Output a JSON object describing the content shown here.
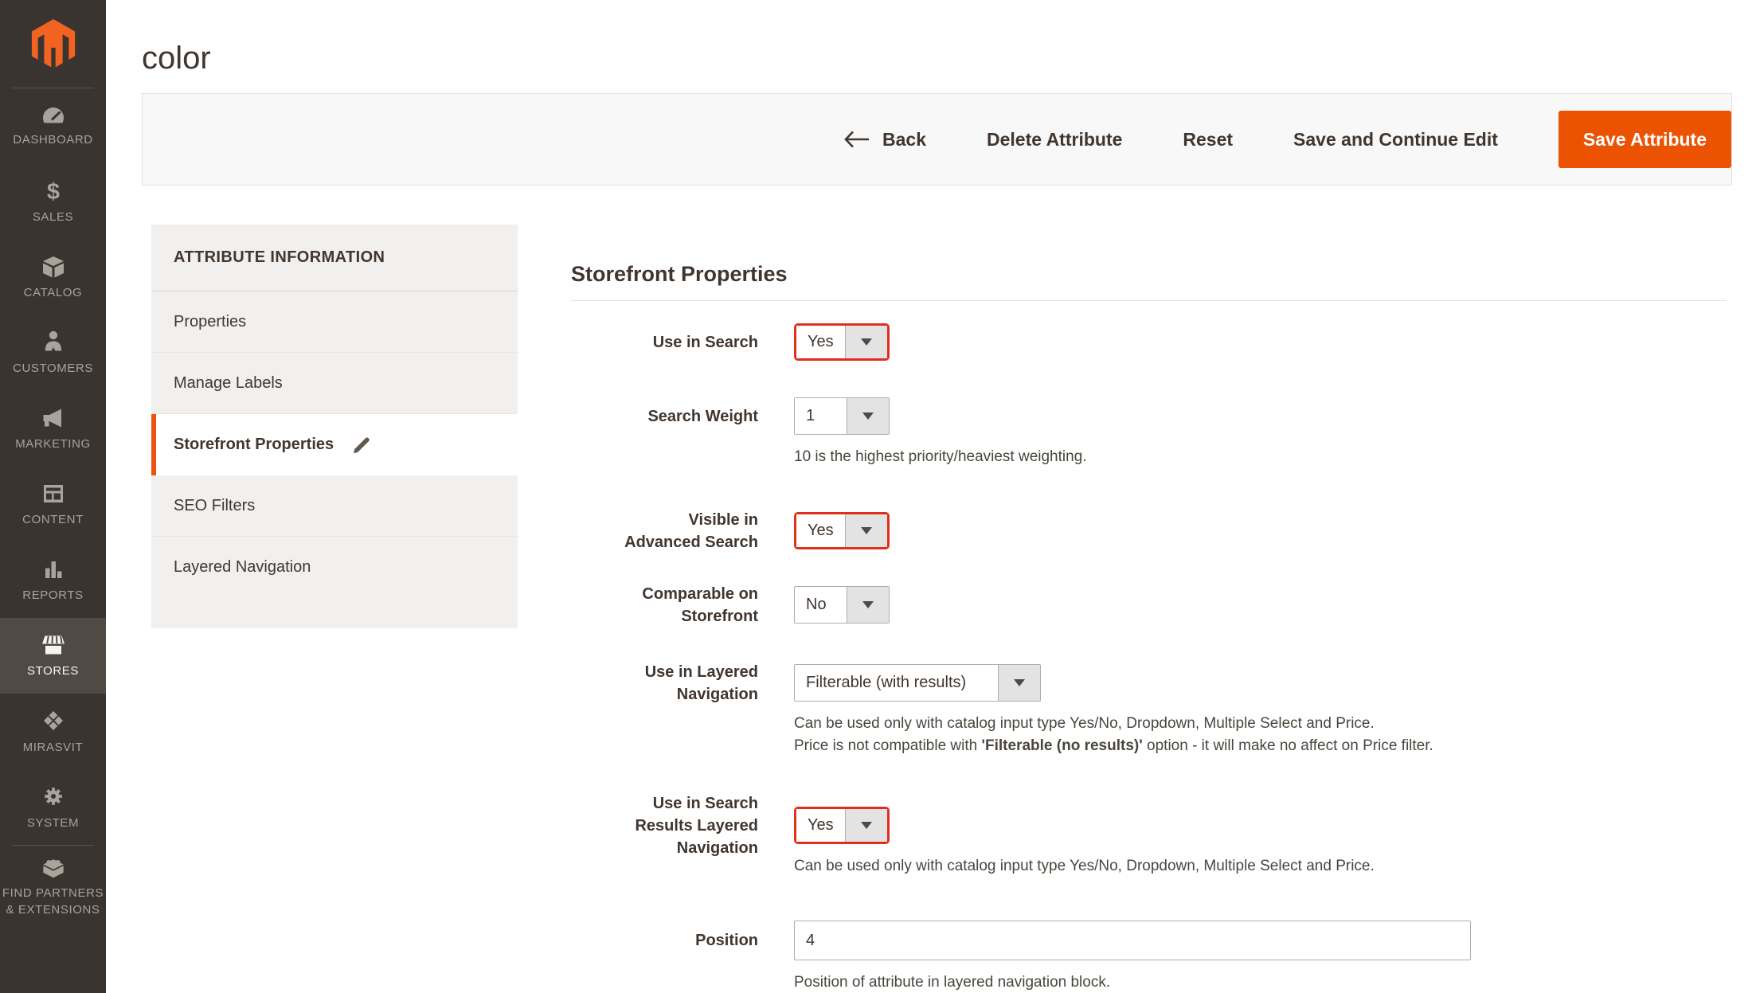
{
  "colors": {
    "accent_orange": "#eb5202",
    "logo_orange": "#f26322",
    "field_highlight_border": "#e0301c",
    "sidebar_bg": "#393430",
    "sidebar_active_bg": "#504a45"
  },
  "header": {
    "title": "color"
  },
  "sidebar": {
    "items": [
      {
        "label": "DASHBOARD"
      },
      {
        "label": "SALES"
      },
      {
        "label": "CATALOG"
      },
      {
        "label": "CUSTOMERS"
      },
      {
        "label": "MARKETING"
      },
      {
        "label": "CONTENT"
      },
      {
        "label": "REPORTS"
      },
      {
        "label": "STORES",
        "active": true
      },
      {
        "label": "MIRASVIT"
      },
      {
        "label": "SYSTEM"
      },
      {
        "label_lines": [
          "FIND PARTNERS",
          "& EXTENSIONS"
        ]
      }
    ]
  },
  "toolbar": {
    "back_label": "Back",
    "delete_label": "Delete Attribute",
    "reset_label": "Reset",
    "save_continue_label": "Save and Continue Edit",
    "save_label": "Save Attribute"
  },
  "nav": {
    "header": "ATTRIBUTE INFORMATION",
    "items": [
      {
        "label": "Properties"
      },
      {
        "label": "Manage Labels"
      },
      {
        "label": "Storefront Properties",
        "active": true
      },
      {
        "label": "SEO Filters"
      },
      {
        "label": "Layered Navigation"
      }
    ]
  },
  "form": {
    "heading": "Storefront Properties",
    "rows": {
      "use_in_search": {
        "label": [
          "Use in Search"
        ],
        "value": "Yes"
      },
      "search_weight": {
        "label": [
          "Search Weight"
        ],
        "value": "1",
        "note": "10 is the highest priority/heaviest weighting."
      },
      "visible_in_advanced_search": {
        "label": [
          "Visible in",
          "Advanced Search"
        ],
        "value": "Yes"
      },
      "comparable_on_storefront": {
        "label": [
          "Comparable on",
          "Storefront"
        ],
        "value": "No"
      },
      "use_in_layered_navigation": {
        "label": [
          "Use in Layered",
          "Navigation"
        ],
        "value": "Filterable (with results)",
        "note1": "Can be used only with catalog input type Yes/No, Dropdown, Multiple Select and Price.",
        "note2_parts": [
          "Price is not compatible with ",
          "'Filterable (no results)'",
          " option - it will make no affect on Price filter."
        ]
      },
      "use_in_search_results_layered_navigation": {
        "label": [
          "Use in Search",
          "Results Layered",
          "Navigation"
        ],
        "value": "Yes",
        "note": "Can be used only with catalog input type Yes/No, Dropdown, Multiple Select and Price."
      },
      "position": {
        "label": [
          "Position"
        ],
        "value": "4",
        "note": "Position of attribute in layered navigation block."
      }
    }
  }
}
